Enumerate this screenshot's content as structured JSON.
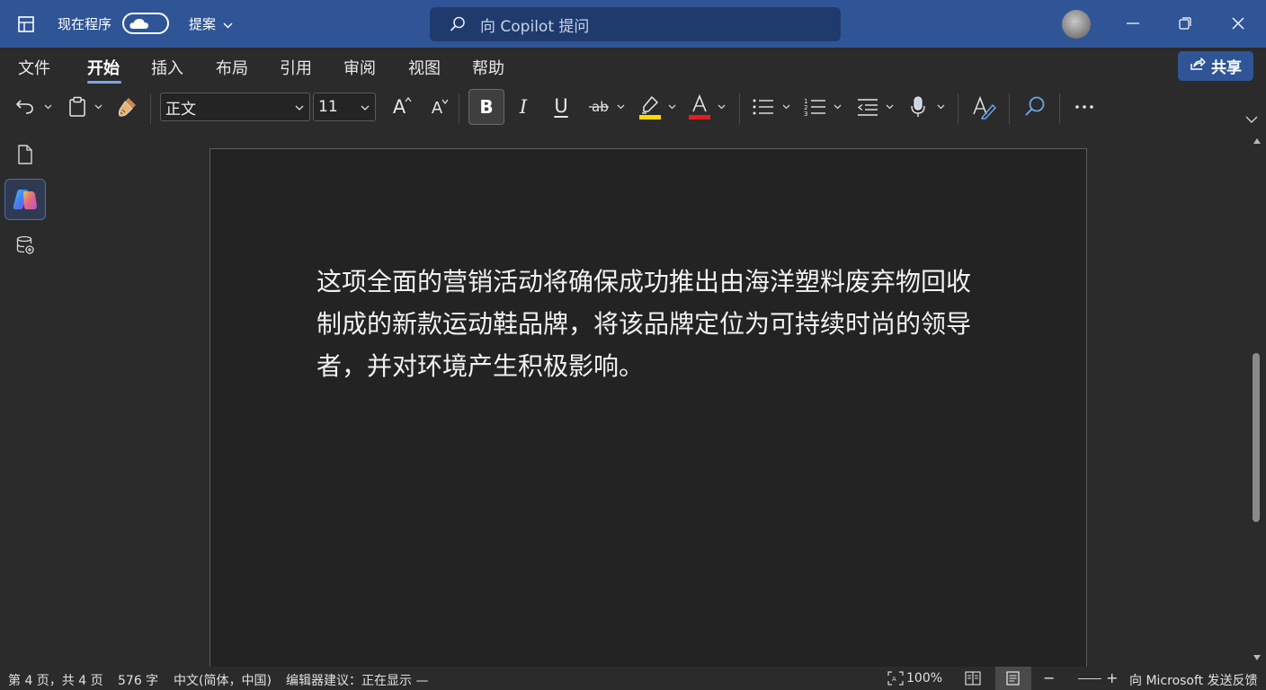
{
  "titlebar": {
    "autosave_label": "现在程序",
    "proposal_label": "提案",
    "search_placeholder": "向 Copilot 提问"
  },
  "tabs": [
    "文件",
    "开始",
    "插入",
    "布局",
    "引用",
    "审阅",
    "视图",
    "帮助"
  ],
  "active_tab": "开始",
  "share_label": "共享",
  "toolbar": {
    "style_value": "正文",
    "font_size_value": "11",
    "grow_font": "A",
    "shrink_font": "A",
    "bold": "B",
    "italic": "I",
    "underline": "U",
    "highlight_color": "#ffd800",
    "font_color": "#e02020"
  },
  "document": {
    "text": "这项全面的营销活动将确保成功推出由海洋塑料废弃物回收制成的新款运动鞋品牌，将该品牌定位为可持续时尚的领导者，并对环境产生积极影响。"
  },
  "statusbar": {
    "page_info": "第 4 页，共 4 页",
    "word_count": "576 字",
    "language": "中文(简体，中国)",
    "editor_suggestion": "编辑器建议：正在显示 —",
    "zoom": "100%",
    "zoom_minus": "−",
    "zoom_plus": "+",
    "feedback": "向 Microsoft 发送反馈"
  },
  "colors": {
    "titlebar_bg": "#2f5597",
    "accent": "#7aa7e8",
    "app_bg": "#2b2b2b",
    "page_bg": "#232323"
  },
  "icons": [
    "app-grid-icon",
    "cloud-icon",
    "chevron-down-icon",
    "search-icon",
    "minimize-icon",
    "restore-icon",
    "close-icon",
    "share-icon",
    "undo-icon",
    "clipboard-icon",
    "format-painter-icon",
    "strikethrough-icon",
    "highlighter-icon",
    "font-color-icon",
    "bullets-icon",
    "numbering-icon",
    "indent-icon",
    "dictate-icon",
    "editor-icon",
    "find-icon",
    "more-icon",
    "document-icon",
    "copilot-icon",
    "database-icon",
    "focus-icon",
    "read-mode-icon",
    "print-layout-icon"
  ]
}
